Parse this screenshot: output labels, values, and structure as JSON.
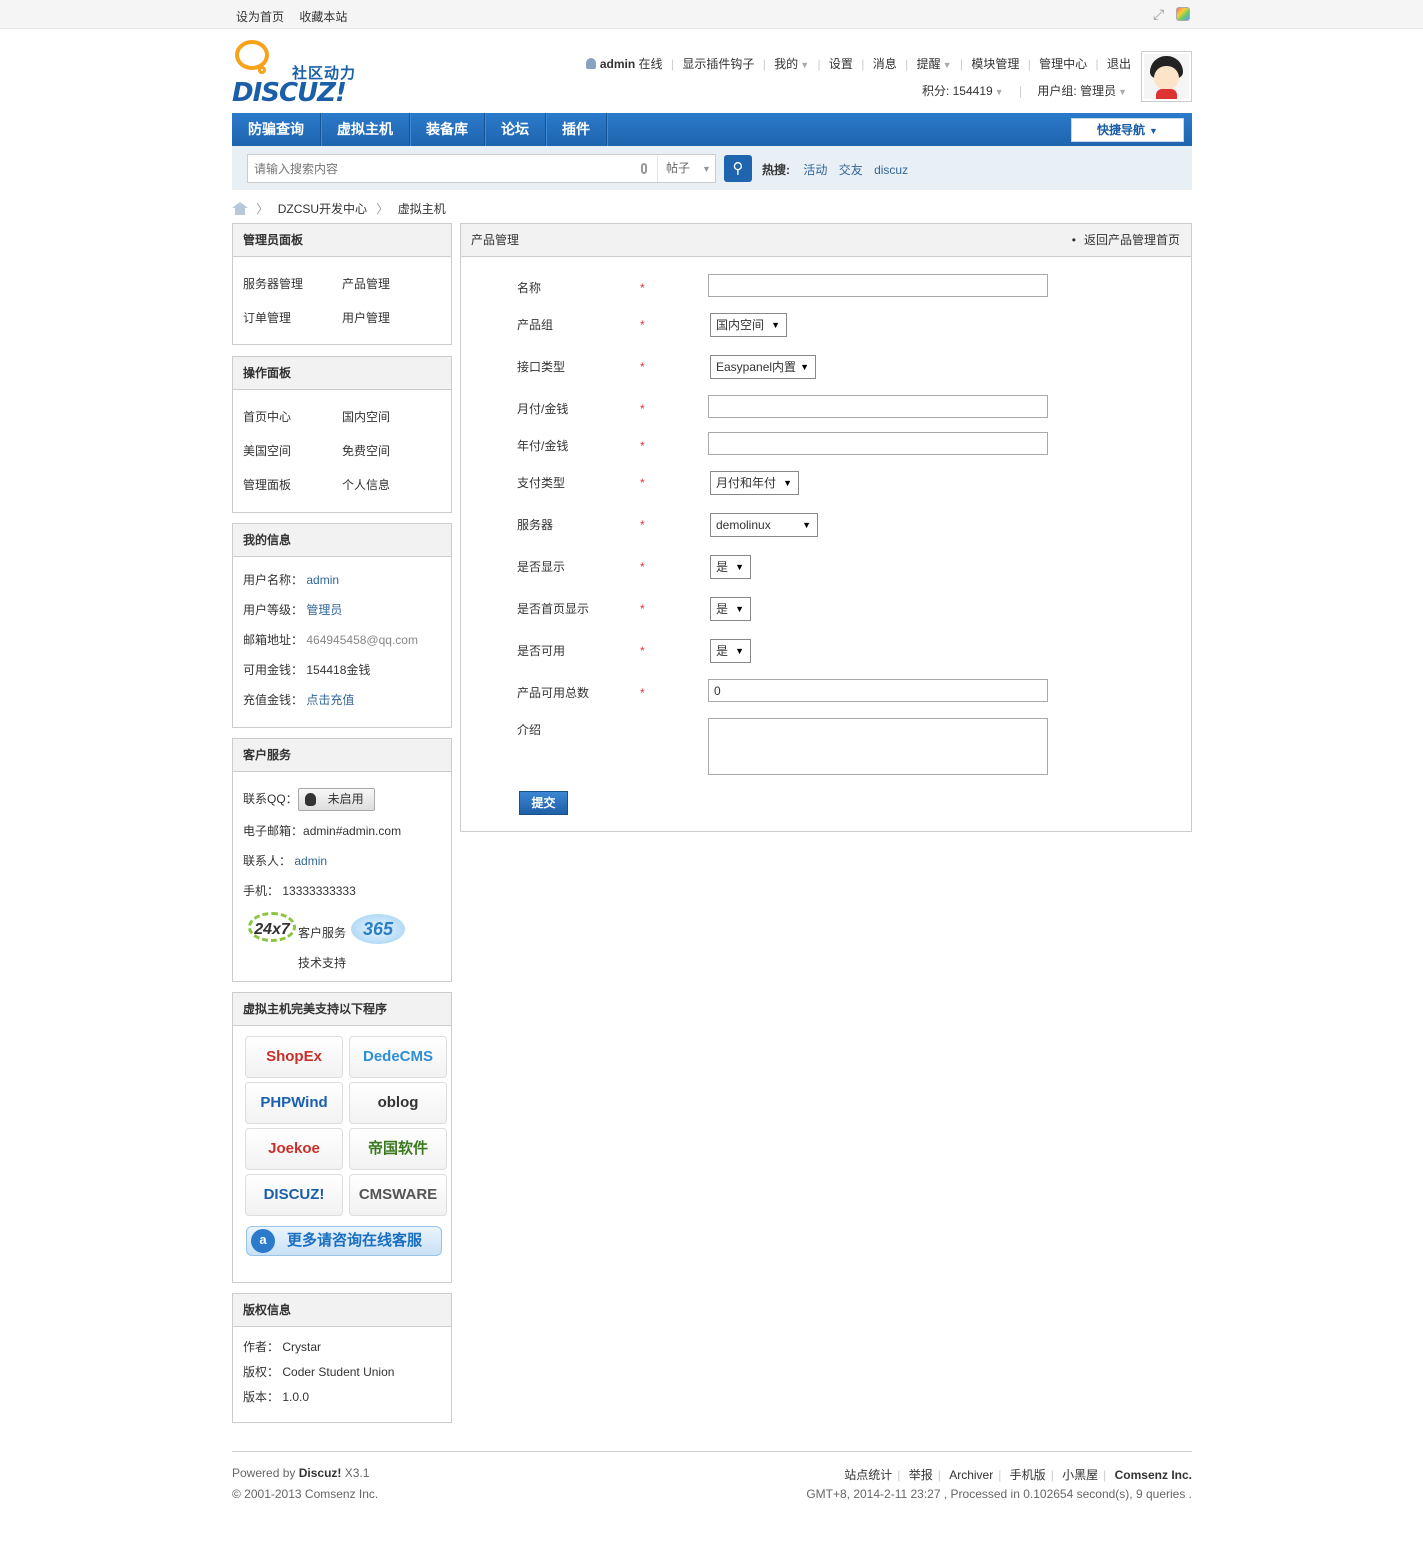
{
  "topbar": {
    "set_home": "设为首页",
    "bookmark": "收藏本站"
  },
  "logo": {
    "cn": "社区动力",
    "en": "DISCUZ!"
  },
  "user": {
    "name": "admin",
    "status": "在线",
    "links": [
      "显示插件钩子",
      "我的",
      "设置",
      "消息",
      "提醒",
      "模块管理",
      "管理中心",
      "退出"
    ],
    "credits_label": "积分: 154419",
    "group_label": "用户组: 管理员"
  },
  "nav": {
    "items": [
      "防骗查询",
      "虚拟主机",
      "装备库",
      "论坛",
      "插件"
    ],
    "quick": "快捷导航"
  },
  "search": {
    "placeholder": "请输入搜索内容",
    "type": "帖子",
    "hot_label": "热搜:",
    "hot": [
      "活动",
      "交友",
      "discuz"
    ]
  },
  "breadcrumb": [
    "DZCSU开发中心",
    "虚拟主机"
  ],
  "admin_panel": {
    "title": "管理员面板",
    "items": [
      "服务器管理",
      "产品管理",
      "订单管理",
      "用户管理"
    ]
  },
  "op_panel": {
    "title": "操作面板",
    "items": [
      "首页中心",
      "国内空间",
      "美国空间",
      "免费空间",
      "管理面板",
      "个人信息"
    ]
  },
  "my_info": {
    "title": "我的信息",
    "rows": [
      {
        "label": "用户名称：",
        "value": "admin"
      },
      {
        "label": "用户等级：",
        "value": "管理员"
      },
      {
        "label": "邮箱地址：",
        "value": "464945458@qq.com"
      },
      {
        "label": "可用金钱：",
        "value": "154418金钱"
      },
      {
        "label": "充值金钱：",
        "value": "点击充值"
      }
    ]
  },
  "service": {
    "title": "客户服务",
    "qq_label": "联系QQ：",
    "qq_btn": "未启用",
    "email_label": "电子邮箱：",
    "email": "admin#admin.com",
    "contact_label": "联系人：",
    "contact": "admin",
    "phone_label": "手机：",
    "phone": "13333333333",
    "badge_left": "24x7",
    "badge_text1": "客户服务",
    "badge_text2": "技术支持",
    "badge_right": "365"
  },
  "programs": {
    "title": "虚拟主机完美支持以下程序",
    "logos": [
      {
        "name": "ShopEx",
        "color": "#c9302c"
      },
      {
        "name": "DedeCMS",
        "color": "#2f8fd3"
      },
      {
        "name": "PHPWind",
        "color": "#1b5fb0"
      },
      {
        "name": "oblog",
        "color": "#333333"
      },
      {
        "name": "Joekoe",
        "color": "#c9302c"
      },
      {
        "name": "帝国软件",
        "color": "#3a7a1f"
      },
      {
        "name": "DISCUZ!",
        "color": "#1a5fa8"
      },
      {
        "name": "CMSWARE",
        "color": "#555555"
      }
    ],
    "more": "更多请咨询在线客服"
  },
  "copyright": {
    "title": "版权信息",
    "rows": [
      {
        "label": "作者：",
        "value": "Crystar"
      },
      {
        "label": "版权：",
        "value": "Coder Student Union"
      },
      {
        "label": "版本：",
        "value": "1.0.0"
      }
    ]
  },
  "form": {
    "title": "产品管理",
    "back": "返回产品管理首页",
    "fields": [
      {
        "label": "名称",
        "type": "text",
        "value": ""
      },
      {
        "label": "产品组",
        "type": "select",
        "value": "国内空间"
      },
      {
        "label": "接口类型",
        "type": "select",
        "value": "Easypanel内置"
      },
      {
        "label": "月付/金钱",
        "type": "text",
        "value": ""
      },
      {
        "label": "年付/金钱",
        "type": "text",
        "value": ""
      },
      {
        "label": "支付类型",
        "type": "select",
        "value": "月付和年付"
      },
      {
        "label": "服务器",
        "type": "select",
        "value": "demolinux"
      },
      {
        "label": "是否显示",
        "type": "select",
        "value": "是"
      },
      {
        "label": "是否首页显示",
        "type": "select",
        "value": "是"
      },
      {
        "label": "是否可用",
        "type": "select",
        "value": "是"
      },
      {
        "label": "产品可用总数",
        "type": "text",
        "value": "0"
      },
      {
        "label": "介绍",
        "type": "textarea",
        "value": ""
      }
    ],
    "required_mark": "*",
    "submit": "提交"
  },
  "footer": {
    "powered_prefix": "Powered by",
    "powered_brand": "Discuz!",
    "powered_version": "X3.1",
    "copyright": "© 2001-2013 Comsenz Inc.",
    "links": [
      "站点统计",
      "举报",
      "Archiver",
      "手机版",
      "小黑屋"
    ],
    "company": "Comsenz Inc.",
    "stats": "GMT+8, 2014-2-11 23:27 , Processed in 0.102654 second(s), 9 queries ."
  }
}
